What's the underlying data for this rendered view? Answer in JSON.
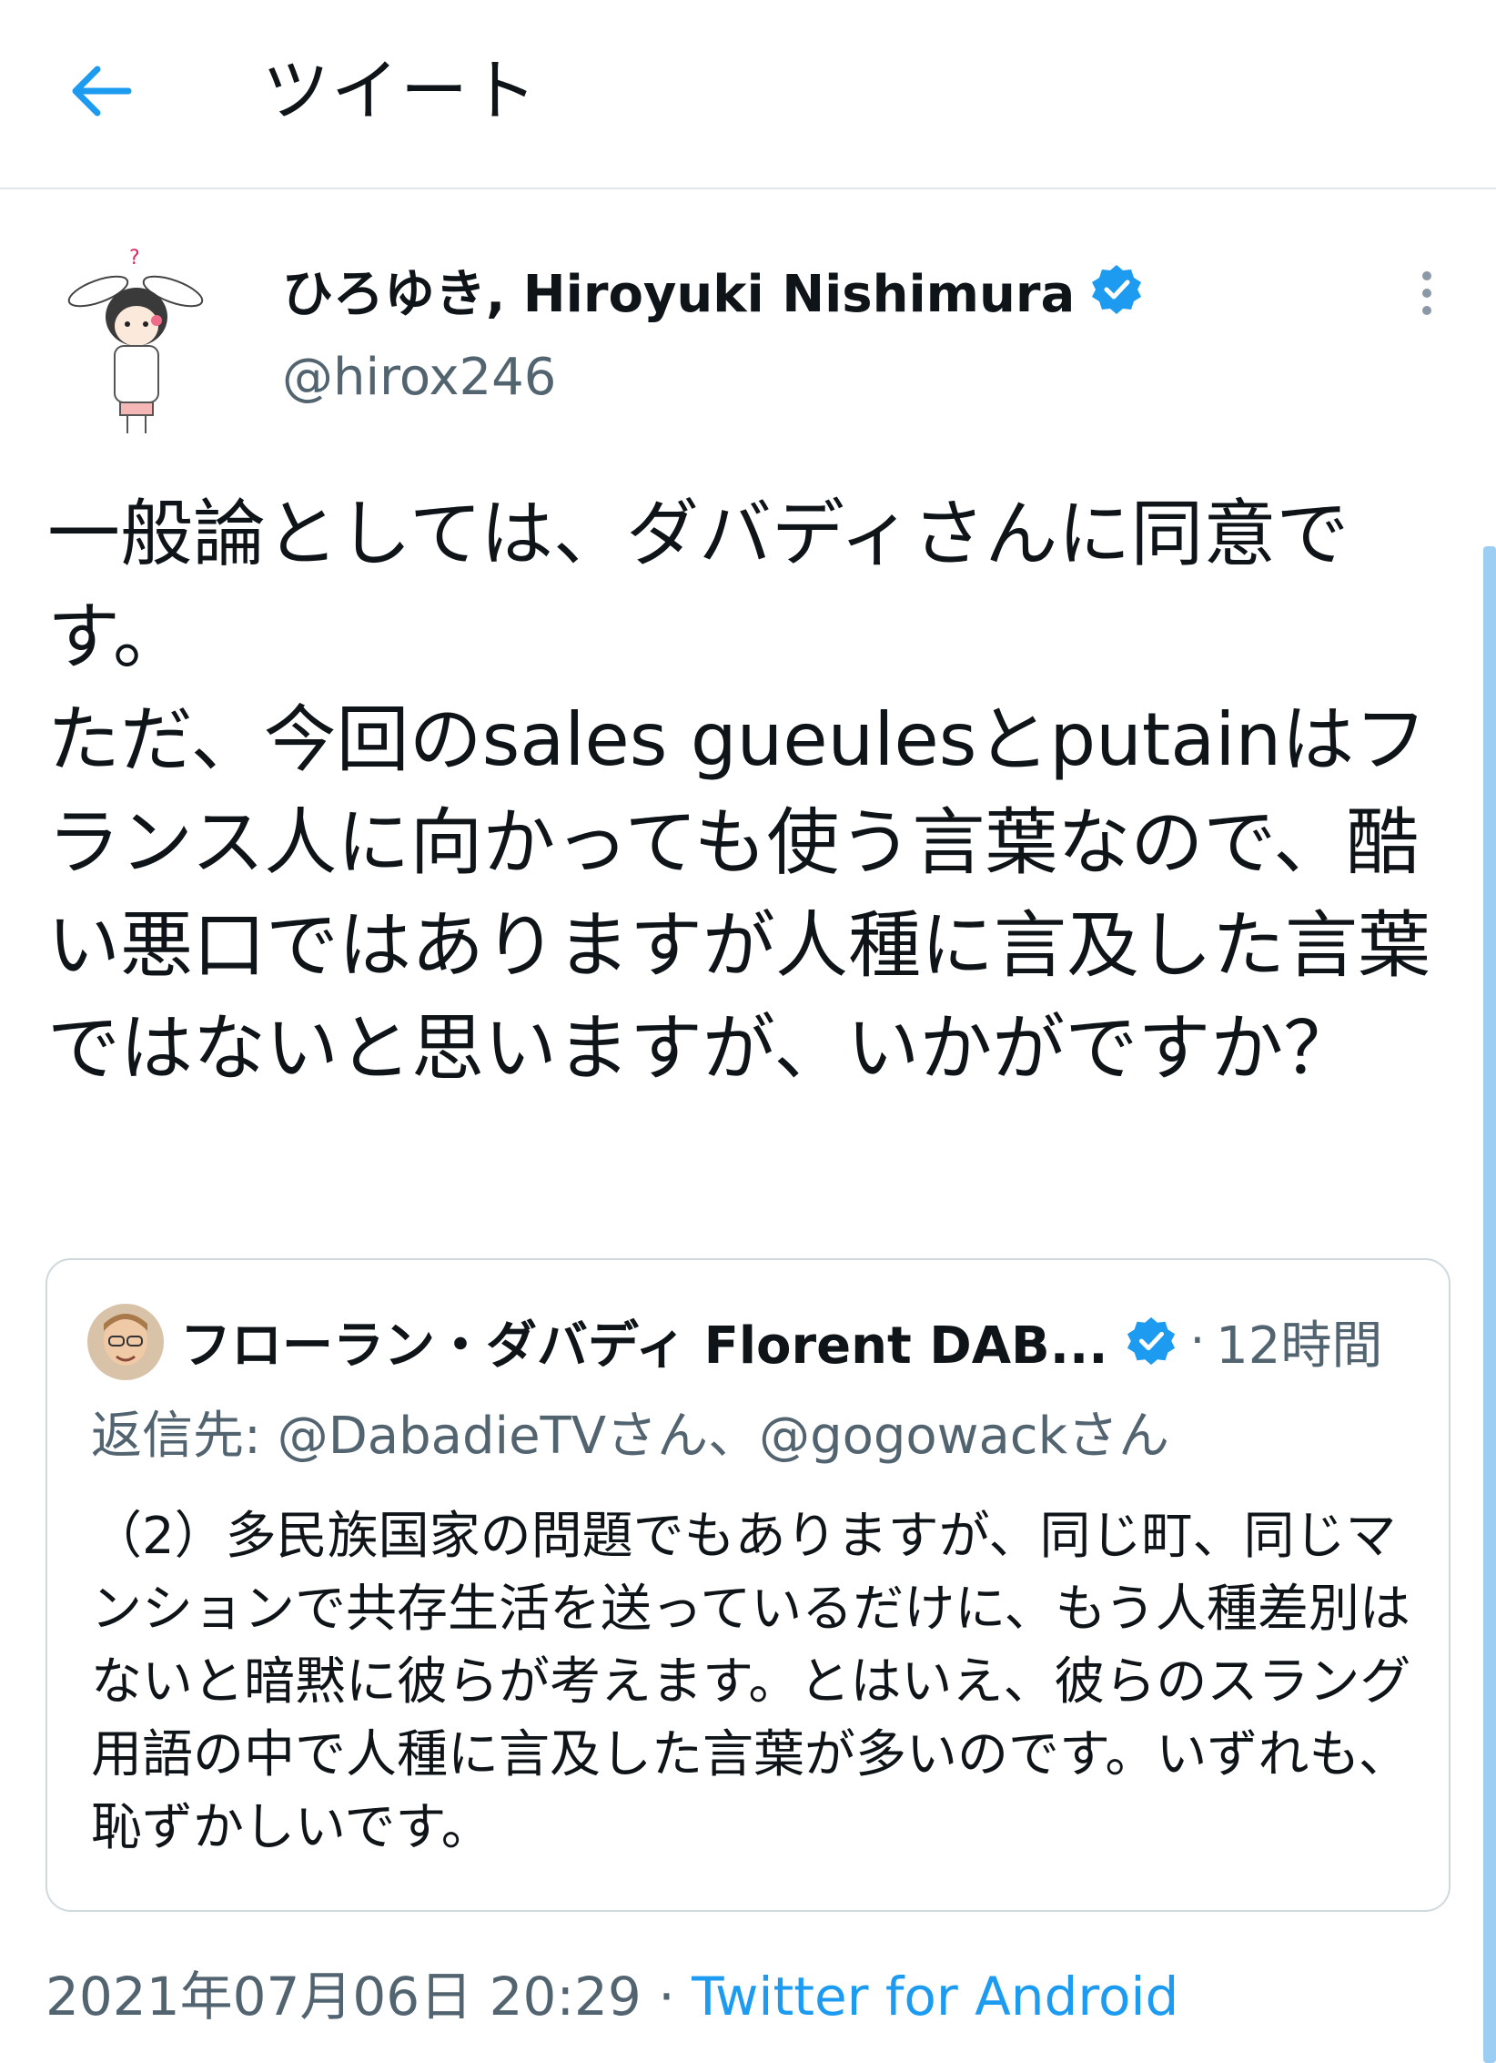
{
  "header": {
    "title": "ツイート",
    "back_icon": "back-arrow-icon",
    "accent_color": "#1d9bf0"
  },
  "tweet": {
    "author": {
      "display_name": "ひろゆき, Hiroyuki Nishimura",
      "handle": "@hirox246",
      "verified_icon": "verified-badge-icon"
    },
    "text": "一般論としては、ダバディさんに同意です。\nただ、今回のsales gueulesとputainはフランス人に向かっても使う言葉なので、酷い悪口ではありますが人種に言及した言葉ではないと思いますが、いかがですか？",
    "timestamp": "2021年07月06日 20:29",
    "separator": "·",
    "source": "Twitter for Android"
  },
  "quote": {
    "author_name": "フローラン・ダバディ Florent DAB...",
    "separator": "·",
    "time": "12時間",
    "reply_label": "返信先:",
    "reply_to": "@DabadieTVさん、@gogowackさん",
    "text": "（2）多民族国家の問題でもありますが、同じ町、同じマンションで共存生活を送っているだけに、もう人種差別はないと暗黙に彼らが考えます。とはいえ、彼らのスラング用語の中で人種に言及した言葉が多いのです。いずれも、恥ずかしいです。"
  },
  "colors": {
    "text_primary": "#0f1419",
    "text_secondary": "#536471",
    "link": "#1d9bf0",
    "border": "#cfd9de"
  }
}
